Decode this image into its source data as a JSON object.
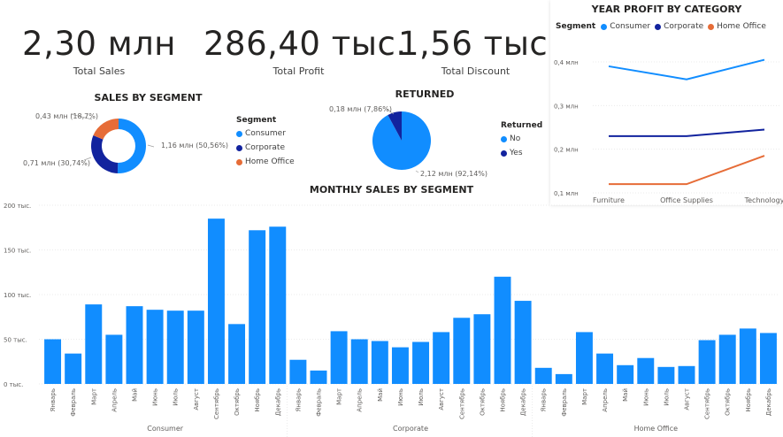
{
  "kpis": [
    {
      "value": "2,30 млн",
      "label": "Total Sales"
    },
    {
      "value": "286,40 тыс.",
      "label": "Total Profit"
    },
    {
      "value": "1,56 тыс.",
      "label": "Total Discount"
    }
  ],
  "colors": {
    "consumer": "#118DFF",
    "corporate": "#12239E",
    "home_office": "#E66C37",
    "no": "#118DFF",
    "yes": "#12239E"
  },
  "chart_data": [
    {
      "type": "pie",
      "variant": "donut",
      "title": "SALES BY SEGMENT",
      "legend_title": "Segment",
      "legend_position": "right",
      "slices": [
        {
          "name": "Consumer",
          "value": 1.16,
          "percent": 50.56,
          "label": "1,16 млн (50,56%)"
        },
        {
          "name": "Corporate",
          "value": 0.71,
          "percent": 30.74,
          "label": "0,71 млн (30,74%)"
        },
        {
          "name": "Home Office",
          "value": 0.43,
          "percent": 18.7,
          "label": "0,43 млн (18,7%)"
        }
      ]
    },
    {
      "type": "pie",
      "title": "RETURNED",
      "legend_title": "Returned",
      "legend_position": "right",
      "slices": [
        {
          "name": "No",
          "value": 2.12,
          "percent": 92.14,
          "label": "2,12 млн (92,14%)"
        },
        {
          "name": "Yes",
          "value": 0.18,
          "percent": 7.86,
          "label": "0,18 млн (7,86%)"
        }
      ]
    },
    {
      "type": "line",
      "title": "YEAR PROFIT BY CATEGORY",
      "legend_title": "Segment",
      "legend_position": "top",
      "categories": [
        "Furniture",
        "Office Supplies",
        "Technology"
      ],
      "ylim": [
        0.1,
        0.4
      ],
      "yticks": [
        "0,1 млн",
        "0,2 млн",
        "0,3 млн",
        "0,4 млн"
      ],
      "series": [
        {
          "name": "Consumer",
          "values": [
            0.39,
            0.36,
            0.405
          ]
        },
        {
          "name": "Corporate",
          "values": [
            0.23,
            0.23,
            0.245
          ]
        },
        {
          "name": "Home Office",
          "values": [
            0.12,
            0.12,
            0.185
          ]
        }
      ]
    },
    {
      "type": "bar",
      "title": "MONTHLY SALES BY SEGMENT",
      "ylim": [
        0,
        200
      ],
      "yticks": [
        "0 тыс.",
        "50 тыс.",
        "100 тыс.",
        "150 тыс.",
        "200 тыс."
      ],
      "months": [
        "Январь",
        "Февраль",
        "Март",
        "Апрель",
        "Май",
        "Июнь",
        "Июль",
        "Август",
        "Сентябрь",
        "Октябрь",
        "Ноябрь",
        "Декабрь"
      ],
      "groups": [
        {
          "name": "Consumer",
          "values": [
            50,
            34,
            89,
            55,
            87,
            83,
            82,
            82,
            185,
            67,
            172,
            176
          ]
        },
        {
          "name": "Corporate",
          "values": [
            27,
            15,
            59,
            50,
            48,
            41,
            47,
            58,
            74,
            78,
            120,
            93
          ]
        },
        {
          "name": "Home Office",
          "values": [
            18,
            11,
            58,
            34,
            21,
            29,
            19,
            20,
            49,
            55,
            62,
            57
          ]
        }
      ],
      "grid": true
    }
  ]
}
